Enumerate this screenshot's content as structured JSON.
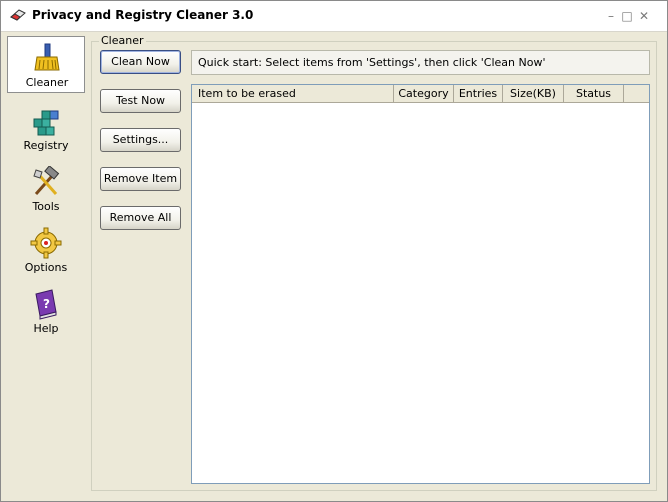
{
  "window": {
    "title": "Privacy and Registry Cleaner 3.0",
    "controls": [
      "minimize",
      "maximize",
      "close"
    ]
  },
  "sidebar": {
    "items": [
      {
        "label": "Cleaner",
        "icon": "broom-icon",
        "active": true
      },
      {
        "label": "Registry",
        "icon": "registry-cubes-icon",
        "active": false
      },
      {
        "label": "Tools",
        "icon": "hammer-tools-icon",
        "active": false
      },
      {
        "label": "Options",
        "icon": "gear-icon",
        "active": false
      },
      {
        "label": "Help",
        "icon": "help-book-icon",
        "active": false
      }
    ]
  },
  "cleaner": {
    "group_label": "Cleaner",
    "buttons": {
      "clean_now": "Clean Now",
      "test_now": "Test Now",
      "settings": "Settings...",
      "remove_item": "Remove Item",
      "remove_all": "Remove All"
    },
    "quick_start": "Quick start: Select items from 'Settings', then click 'Clean Now'",
    "columns": [
      "Item to be erased",
      "Category",
      "Entries",
      "Size(KB)",
      "Status"
    ],
    "rows": []
  },
  "colors": {
    "window_bg": "#ece9d8",
    "list_bg": "#ffffff",
    "active_item_bg": "#ffffff"
  }
}
